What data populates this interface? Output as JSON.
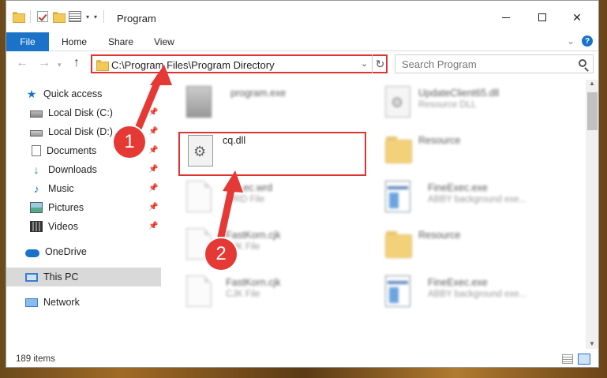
{
  "window": {
    "title": "Program"
  },
  "ribbon": {
    "tabs": [
      "File",
      "Home",
      "Share",
      "View"
    ]
  },
  "address": {
    "path": "C:\\Program Files\\Program Directory"
  },
  "search": {
    "placeholder": "Search Program"
  },
  "sidebar": {
    "items": [
      {
        "label": "Quick access",
        "icon": "star-icon"
      },
      {
        "label": "Local Disk (C:)",
        "icon": "drive-icon",
        "pinned": true
      },
      {
        "label": "Local Disk (D:)",
        "icon": "drive-icon",
        "pinned": true
      },
      {
        "label": "Documents",
        "icon": "documents-icon",
        "pinned": true
      },
      {
        "label": "Downloads",
        "icon": "download-icon",
        "pinned": true
      },
      {
        "label": "Music",
        "icon": "music-icon",
        "pinned": true
      },
      {
        "label": "Pictures",
        "icon": "pictures-icon",
        "pinned": true
      },
      {
        "label": "Videos",
        "icon": "videos-icon",
        "pinned": true
      },
      {
        "label": "OneDrive",
        "icon": "cloud-icon"
      },
      {
        "label": "This PC",
        "icon": "pc-icon",
        "selected": true
      },
      {
        "label": "Network",
        "icon": "network-icon"
      }
    ]
  },
  "files": [
    {
      "name": "program.exe",
      "type": ""
    },
    {
      "name": "UpdateClient65.dll",
      "type": "Resource DLL"
    },
    {
      "name": "cq.dll",
      "type": ""
    },
    {
      "name": "Resource",
      "type": ""
    },
    {
      "name": "Ab..ec.wrd",
      "type": "WRD File"
    },
    {
      "name": "FineExec.exe",
      "type": "ABBY background exe..."
    },
    {
      "name": "FastKorn.cjk",
      "type": "CJK File"
    },
    {
      "name": "Resource",
      "type": ""
    },
    {
      "name": "FastKorn.cjk",
      "type": "CJK File"
    },
    {
      "name": "FineExec.exe",
      "type": "ABBY background exe..."
    }
  ],
  "status": {
    "count": "189 items"
  },
  "annotations": {
    "badge1": "1",
    "badge2": "2",
    "color": "#e53935"
  }
}
